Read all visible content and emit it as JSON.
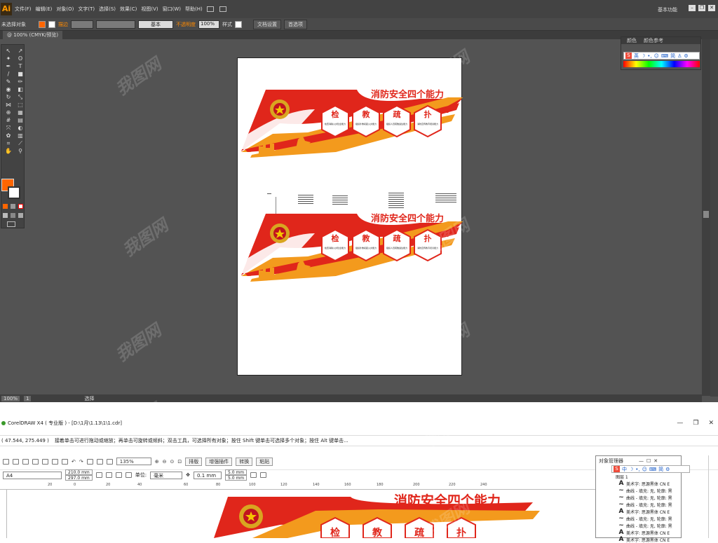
{
  "illustrator": {
    "logo": "Ai",
    "menus": [
      "文件(F)",
      "编辑(E)",
      "对象(O)",
      "文字(T)",
      "选择(S)",
      "效果(C)",
      "视图(V)",
      "窗口(W)",
      "帮助(H)"
    ],
    "workspace": "基本功能",
    "control": {
      "selection_label": "未选择对象",
      "stroke_label": "描边",
      "stroke_style": "基本",
      "opacity_label": "不透明度",
      "opacity_value": "100%",
      "style_label": "样式",
      "doc_setup": "文档设置",
      "preferences": "首选项"
    },
    "tab": "@ 100% (CMYK/预览)",
    "status": {
      "zoom": "100%",
      "page": "1",
      "tool": "选择"
    },
    "color_panel": {
      "tab1": "颜色",
      "tab2": "颜色参考",
      "ime": [
        "英",
        "简"
      ]
    },
    "artwork": {
      "title": "消防安全四个能力",
      "hex_titles": [
        "检",
        "教",
        "疏",
        "扑"
      ],
      "hex_subtitles": [
        "检查消除火灾隐患能力",
        "组织扑救初起火灾能力",
        "组织人员疏散逃生能力",
        "消防宣传教育培训能力"
      ]
    },
    "watermark": "我图网",
    "colors": {
      "fill": "#ff6600",
      "accent": "#ff8a00",
      "banner_red": "#e0261b",
      "banner_orange": "#f39a1d"
    }
  },
  "coreldraw": {
    "title": "CorelDRAW X4 ( 专业版 ) - [D:\\1月\\1.13\\1\\1.cdr]",
    "coords": "( 47.544, 275.449 )",
    "hint": "接着单击可进行拖动或缩放；再单击可旋转或倾斜；双击工具，可选择所有对象；按住 Shift 键单击可选择多个对象；按住 Alt 键单击...",
    "toolbar": {
      "zoom": "135%",
      "snap": "贴齐",
      "plugins": "增强插件",
      "convert": "转换",
      "paste": "粘贴",
      "layout": "排版"
    },
    "properties": {
      "page_size": "A4",
      "width": "210.0 mm",
      "height": "297.0 mm",
      "units_label": "单位:",
      "units": "毫米",
      "nudge": "0.1 mm",
      "dup_x": "5.0 mm",
      "dup_y": "5.0 mm"
    },
    "ruler": [
      "20",
      "0",
      "20",
      "40",
      "60",
      "80",
      "100",
      "120",
      "140",
      "160",
      "180",
      "200",
      "220",
      "240"
    ],
    "object_manager": {
      "title": "对象管理器",
      "layer": "图层 1",
      "rows": [
        {
          "icon": "A",
          "text": "美术字: 思源黑体 CN E"
        },
        {
          "icon": "~",
          "text": "曲线 - 填充: 无, 轮廓: 黑"
        },
        {
          "icon": "~",
          "text": "曲线 - 填充: 无, 轮廓: 黑"
        },
        {
          "icon": "~",
          "text": "曲线 - 填充: 无, 轮廓: 黑"
        },
        {
          "icon": "A",
          "text": "美术字: 思源黑体 CN E"
        },
        {
          "icon": "~",
          "text": "曲线 - 填充: 无, 轮廓: 黑"
        },
        {
          "icon": "~",
          "text": "曲线 - 填充: 无, 轮廓: 黑"
        },
        {
          "icon": "A",
          "text": "美术字: 思源黑体 CN E"
        },
        {
          "icon": "A",
          "text": "美术字: 思源黑体 CN E"
        }
      ]
    },
    "artwork_title": "消防安全四个能力",
    "hex_titles": [
      "检",
      "教",
      "疏",
      "扑"
    ]
  }
}
